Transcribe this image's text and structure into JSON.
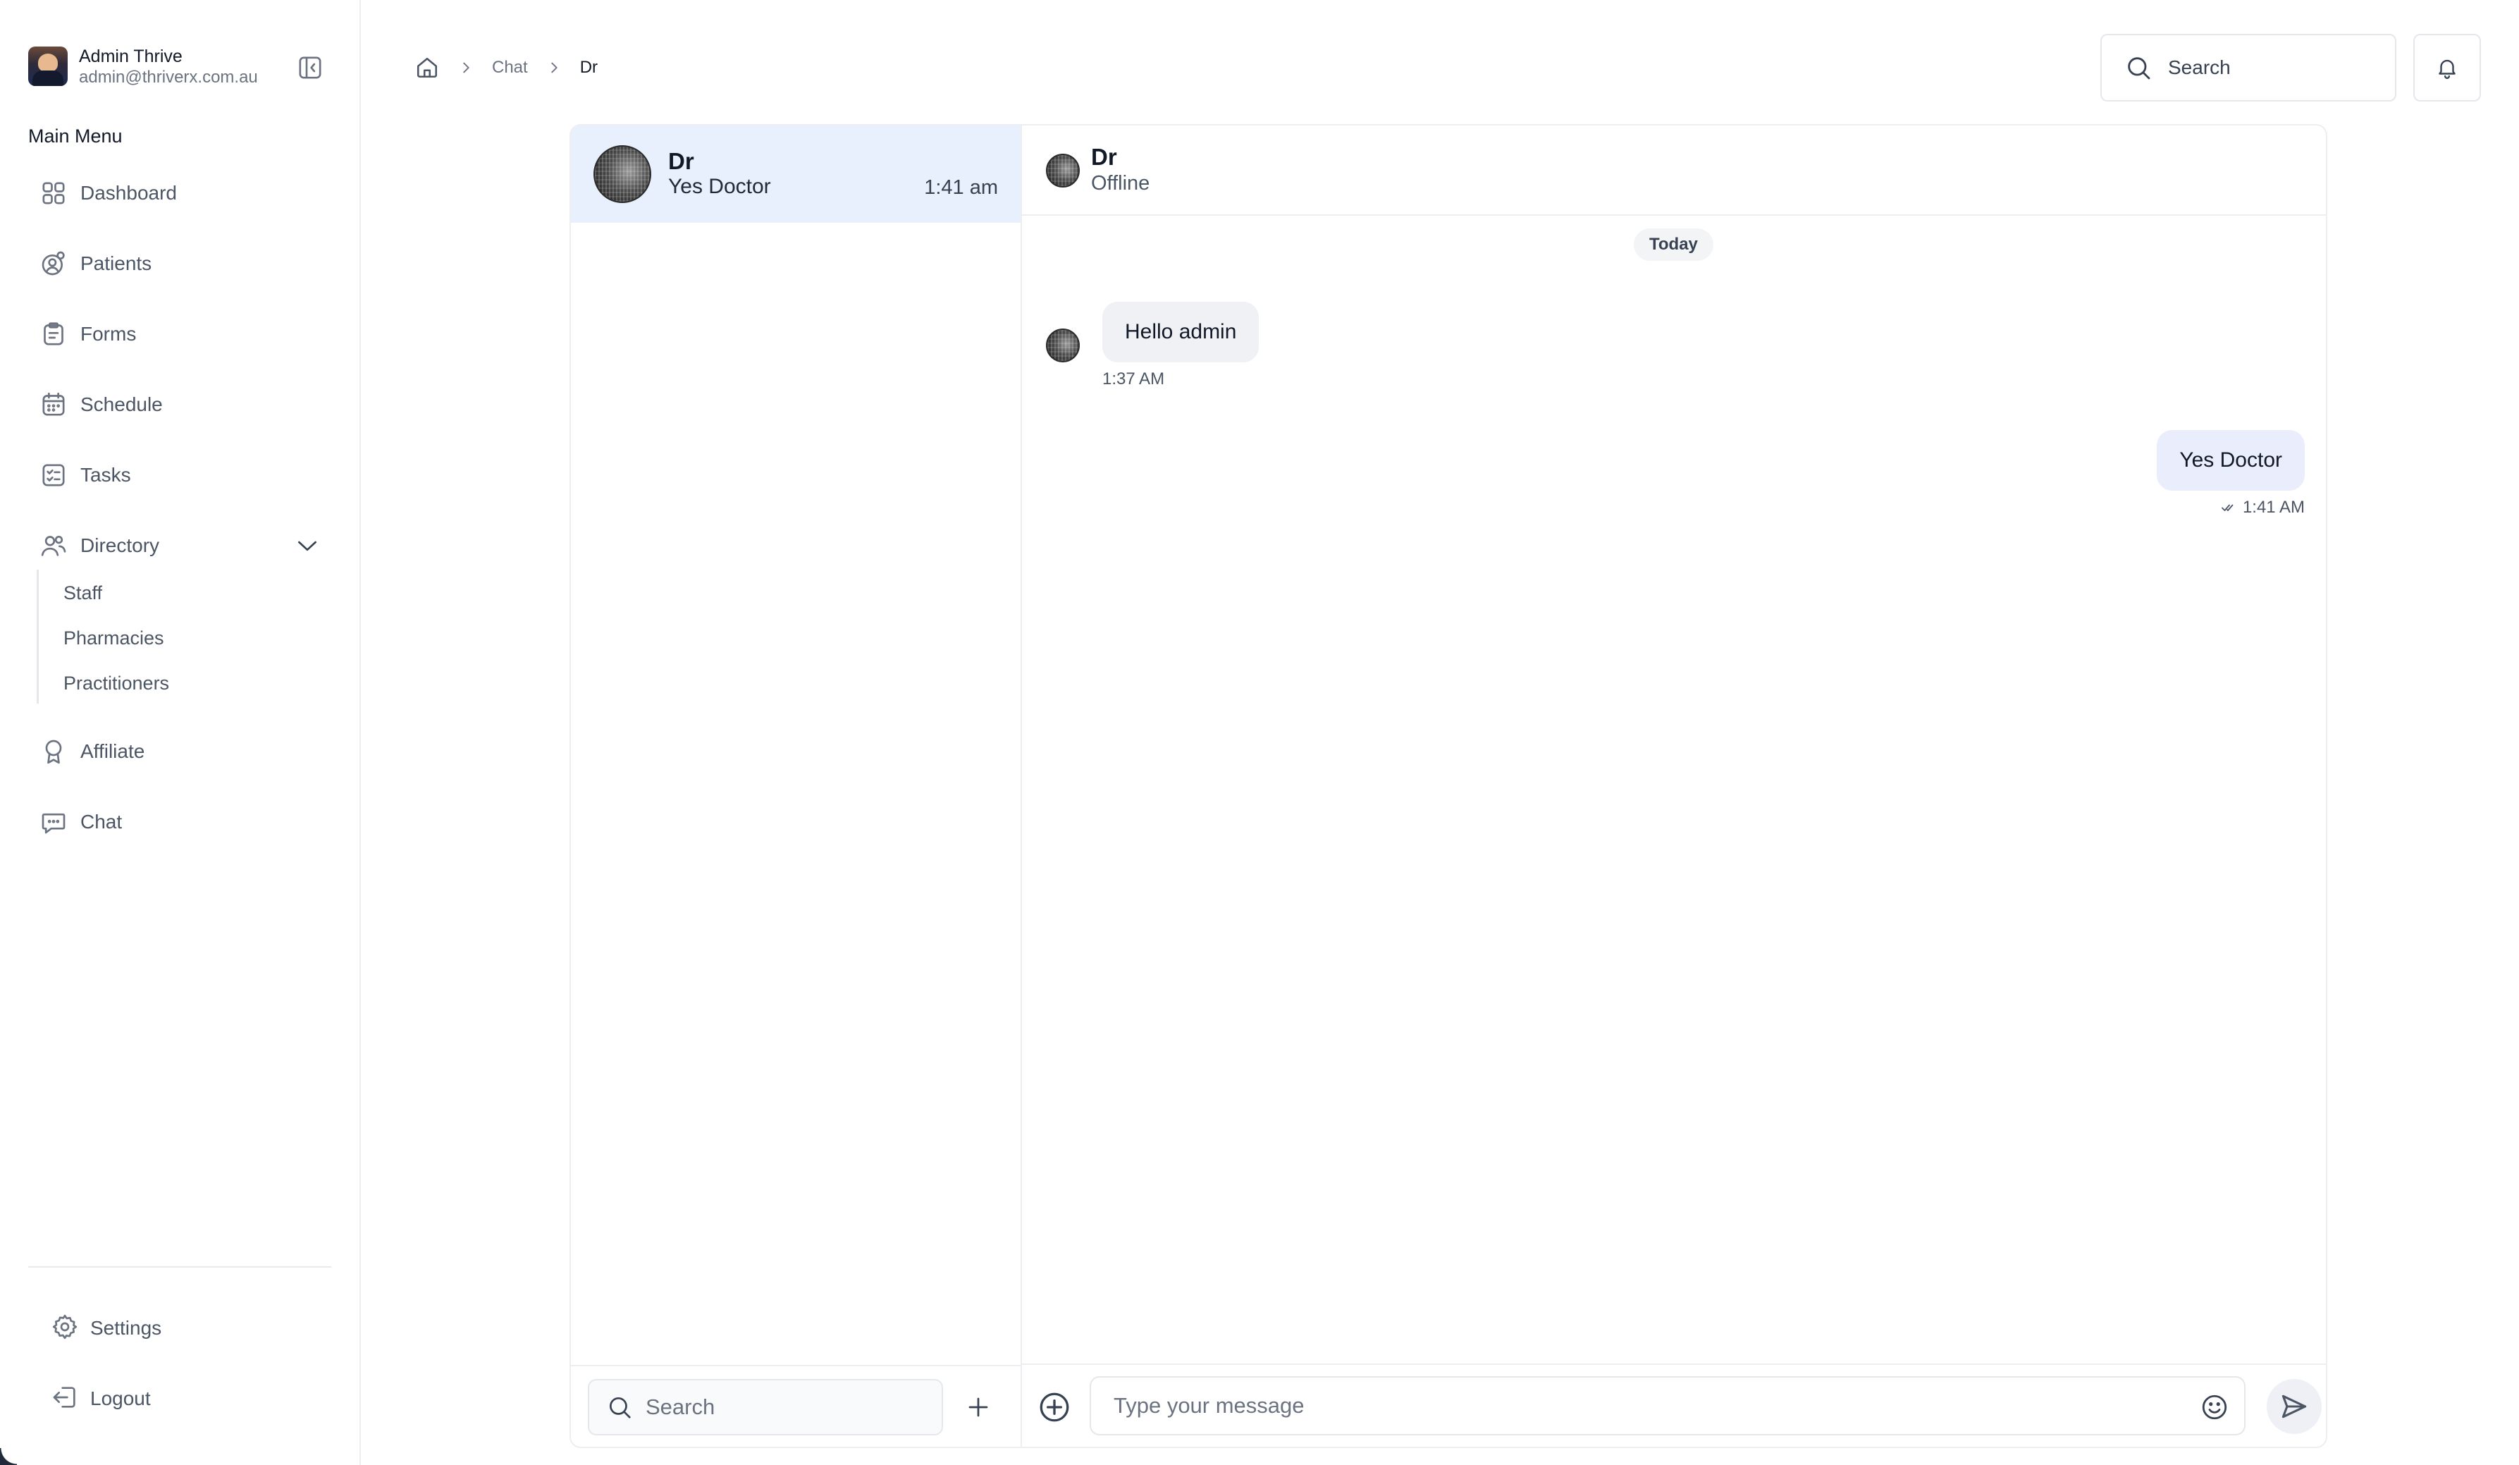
{
  "user": {
    "name": "Admin Thrive",
    "email": "admin@thriverx.com.au"
  },
  "sidebar": {
    "menu_heading": "Main Menu",
    "items": [
      {
        "label": "Dashboard",
        "icon": "grid-icon"
      },
      {
        "label": "Patients",
        "icon": "patients-icon"
      },
      {
        "label": "Forms",
        "icon": "clipboard-icon"
      },
      {
        "label": "Schedule",
        "icon": "calendar-icon"
      },
      {
        "label": "Tasks",
        "icon": "checklist-icon"
      },
      {
        "label": "Directory",
        "icon": "users-icon",
        "expanded": true
      },
      {
        "label": "Affiliate",
        "icon": "award-icon"
      },
      {
        "label": "Chat",
        "icon": "chat-icon"
      }
    ],
    "directory_sub": [
      "Staff",
      "Pharmacies",
      "Practitioners"
    ],
    "bottom": {
      "settings": "Settings",
      "logout": "Logout"
    }
  },
  "breadcrumb": {
    "items": [
      "Chat",
      "Dr"
    ]
  },
  "header": {
    "search_placeholder": "Search"
  },
  "conversations": [
    {
      "name": "Dr",
      "preview": "Yes Doctor",
      "time": "1:41 am",
      "selected": true
    }
  ],
  "conversation_list": {
    "search_placeholder": "Search"
  },
  "active_chat": {
    "name": "Dr",
    "status": "Offline",
    "day_label": "Today",
    "messages": [
      {
        "direction": "incoming",
        "text": "Hello admin",
        "time": "1:37 AM"
      },
      {
        "direction": "outgoing",
        "text": "Yes Doctor",
        "time": "1:41 AM",
        "read": true
      }
    ]
  },
  "composer": {
    "placeholder": "Type your message"
  },
  "colors": {
    "selected_conversation": "#e8effd",
    "outgoing_bubble": "#eaedfc",
    "incoming_bubble": "#f0f1f4",
    "text_primary": "#111827",
    "text_secondary": "#4b5563"
  }
}
